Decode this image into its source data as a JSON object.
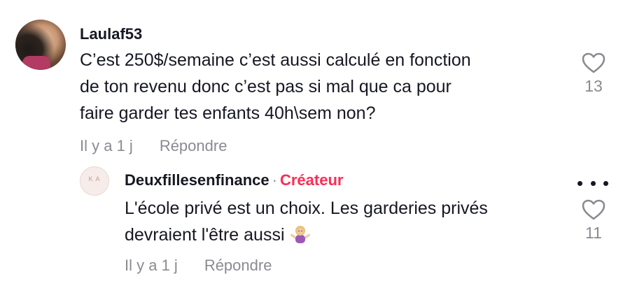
{
  "comment": {
    "username": "Laulaf53",
    "text": "C’est 250$/semaine c’est aussi calculé en fonction de ton revenu donc c’est pas si mal que ca pour faire garder tes enfants 40h\\sem non?",
    "line1": "C’est 250$/semaine c’est aussi calculé en fonction",
    "line2": "de ton revenu donc c’est pas si mal que ca pour",
    "line3": "faire garder tes enfants 40h\\sem non?",
    "time": "Il y a 1 j",
    "reply_label": "Répondre",
    "like_icon": "heart-outline-icon",
    "like_count": "13"
  },
  "reply": {
    "username": "Deuxfillesenfinance",
    "separator": "·",
    "badge": "Créateur",
    "badge_color": "#fe2c55",
    "avatar_initials": "K A",
    "line1": "L'école privé est un choix. Les garderies privés",
    "line2": "devraient l'être aussi",
    "emoji": "woman-shrugging-emoji",
    "time": "Il y a 1 j",
    "reply_label": "Répondre",
    "like_icon": "heart-outline-icon",
    "like_count": "11",
    "more_icon": "more-dots-icon"
  }
}
